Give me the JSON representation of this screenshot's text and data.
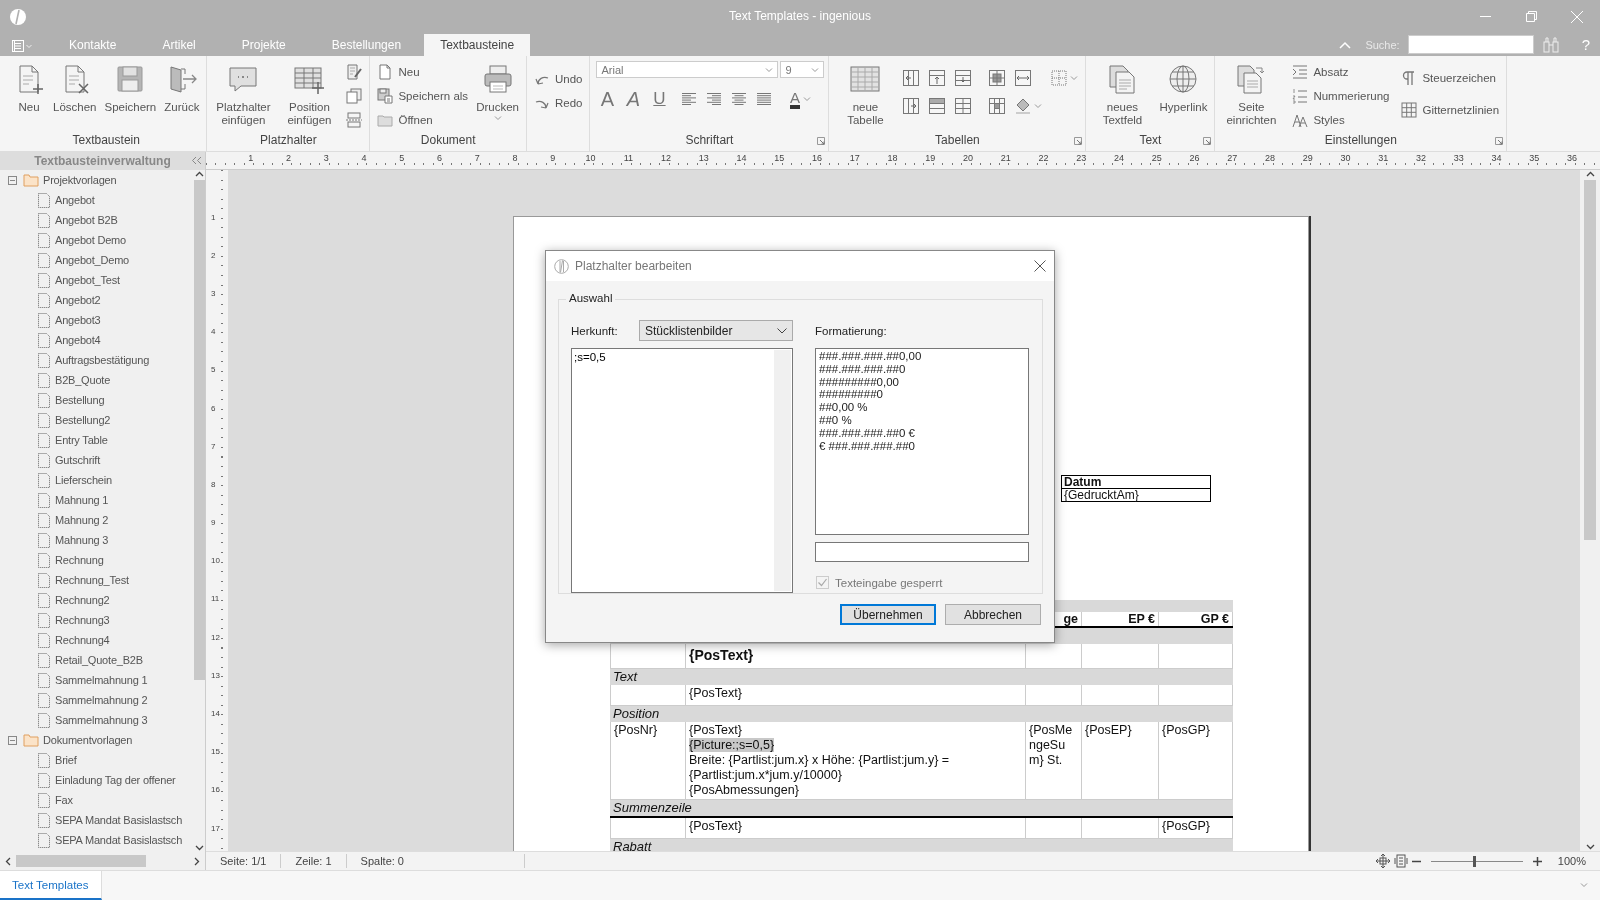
{
  "window": {
    "title": "Text Templates - ingenious"
  },
  "menu_tabs": [
    {
      "label": "Kontakte",
      "selected": false
    },
    {
      "label": "Artikel",
      "selected": false
    },
    {
      "label": "Projekte",
      "selected": false
    },
    {
      "label": "Bestellungen",
      "selected": false
    },
    {
      "label": "Textbausteine",
      "selected": true
    }
  ],
  "search": {
    "label": "Suche:"
  },
  "help": {
    "label": "?"
  },
  "ribbon": [
    {
      "title": "Textbaustein",
      "buttons": [
        {
          "kind": "large",
          "label": "Neu"
        },
        {
          "kind": "large",
          "label": "Löschen"
        },
        {
          "kind": "large",
          "label": "Speichern"
        },
        {
          "kind": "large",
          "label": "Zurück"
        }
      ]
    },
    {
      "title": "Platzhalter",
      "buttons": [
        {
          "kind": "large",
          "label": "Platzhalter einfügen"
        },
        {
          "kind": "large",
          "label": "Position einfügen"
        },
        {
          "kind": "icon"
        },
        {
          "kind": "icon"
        },
        {
          "kind": "icon"
        }
      ]
    },
    {
      "title": "Dokument",
      "buttons": [
        {
          "kind": "small",
          "label": "Neu"
        },
        {
          "kind": "small",
          "label": "Speichern als"
        },
        {
          "kind": "small",
          "label": "Öffnen"
        },
        {
          "kind": "large",
          "label": "Drucken"
        }
      ]
    },
    {
      "buttons": [
        {
          "kind": "small",
          "label": "Undo"
        },
        {
          "kind": "small",
          "label": "Redo"
        }
      ]
    },
    {
      "title": "Schriftart",
      "launcher": true,
      "font": {
        "family": "Arial",
        "size": "9"
      },
      "buttons": [
        {
          "kind": "glyph",
          "label": "A"
        },
        {
          "kind": "glyph",
          "label": "A"
        },
        {
          "kind": "glyph",
          "label": "U"
        },
        {
          "kind": "icon"
        },
        {
          "kind": "icon"
        },
        {
          "kind": "icon"
        },
        {
          "kind": "icon"
        },
        {
          "kind": "glyph",
          "label": "A"
        }
      ]
    },
    {
      "title": "Tabellen",
      "launcher": true,
      "buttons": [
        {
          "kind": "large",
          "label": "neue Tabelle"
        },
        {
          "kind": "icon"
        },
        {
          "kind": "icon"
        },
        {
          "kind": "icon"
        },
        {
          "kind": "icon"
        },
        {
          "kind": "icon"
        },
        {
          "kind": "icon"
        },
        {
          "kind": "icon"
        },
        {
          "kind": "icon"
        },
        {
          "kind": "icon"
        },
        {
          "kind": "icon"
        },
        {
          "kind": "icon"
        }
      ]
    },
    {
      "title": "Text",
      "launcher": true,
      "buttons": [
        {
          "kind": "large",
          "label": "neues Textfeld"
        },
        {
          "kind": "large",
          "label": "Hyperlink"
        }
      ]
    },
    {
      "title": "Einstellungen",
      "launcher": true,
      "buttons": [
        {
          "kind": "large",
          "label": "Seite einrichten"
        },
        {
          "kind": "small",
          "label": "Absatz"
        },
        {
          "kind": "small",
          "label": "Nummerierung"
        },
        {
          "kind": "small",
          "label": "Styles"
        },
        {
          "kind": "small",
          "label": "Steuerzeichen"
        },
        {
          "kind": "small",
          "label": "Gitternetzlinien"
        }
      ]
    }
  ],
  "sidebar": {
    "title": "Textbausteinverwaltung",
    "tree": [
      {
        "label": "Projektvorlagen",
        "expanded": true,
        "children": [
          {
            "label": "Angebot"
          },
          {
            "label": "Angebot B2B"
          },
          {
            "label": "Angebot Demo"
          },
          {
            "label": "Angebot_Demo"
          },
          {
            "label": "Angebot_Test"
          },
          {
            "label": "Angebot2"
          },
          {
            "label": "Angebot3"
          },
          {
            "label": "Angebot4"
          },
          {
            "label": "Auftragsbestätigung"
          },
          {
            "label": "B2B_Quote"
          },
          {
            "label": "Bestellung"
          },
          {
            "label": "Bestellung2"
          },
          {
            "label": "Entry Table"
          },
          {
            "label": "Gutschrift"
          },
          {
            "label": "Lieferschein"
          },
          {
            "label": "Mahnung 1"
          },
          {
            "label": "Mahnung 2"
          },
          {
            "label": "Mahnung 3"
          },
          {
            "label": "Rechnung"
          },
          {
            "label": "Rechnung_Test"
          },
          {
            "label": "Rechnung2"
          },
          {
            "label": "Rechnung3"
          },
          {
            "label": "Rechnung4"
          },
          {
            "label": "Retail_Quote_B2B"
          },
          {
            "label": "Sammelmahnung 1"
          },
          {
            "label": "Sammelmahnung 2"
          },
          {
            "label": "Sammelmahnung 3"
          }
        ]
      },
      {
        "label": "Dokumentvorlagen",
        "expanded": true,
        "children": [
          {
            "label": "Brief"
          },
          {
            "label": "Einladung Tag der offener"
          },
          {
            "label": "Fax"
          },
          {
            "label": "SEPA Mandat Basislastsch"
          },
          {
            "label": "SEPA Mandat Basislastsch"
          }
        ]
      }
    ]
  },
  "ruler": {
    "horizontal": [
      "1",
      "2",
      "3",
      "4",
      "5",
      "6",
      "7",
      "8",
      "9",
      "10",
      "11",
      "12",
      "13",
      "14",
      "15",
      "16",
      "17",
      "18",
      "19",
      "20",
      "21",
      "22",
      "23",
      "24",
      "25",
      "26",
      "27",
      "28",
      "29",
      "30",
      "31",
      "32",
      "33",
      "34",
      "35",
      "36"
    ],
    "vertical": [
      "1",
      "2",
      "3",
      "4",
      "5",
      "6",
      "7",
      "8",
      "9",
      "10",
      "11",
      "12",
      "13",
      "14",
      "15",
      "16",
      "17"
    ]
  },
  "document": {
    "date_box": {
      "header": "Datum",
      "value": "{GedrucktAm}"
    },
    "table": {
      "header": {
        "qty": "ge",
        "ep": "EP €",
        "gp": "GP €"
      },
      "blocks": [
        {
          "rows": [
            {
              "text_lines": [
                {
                  "text": "{PosText}",
                  "highlighted": false
                }
              ],
              "bold": true
            }
          ]
        },
        {
          "title": "Text",
          "rows": [
            {
              "text_lines": [
                {
                  "text": "{PosText}",
                  "highlighted": false
                }
              ],
              "bold": false
            }
          ]
        },
        {
          "title": "Position",
          "rows": [
            {
              "nr": "{PosNr}",
              "text_lines": [
                {
                  "text": "{PosText}",
                  "highlighted": false
                },
                {
                  "text": "{Picture:;s=0,5}",
                  "highlighted": true
                },
                {
                  "text": "Breite: {Partlist:jum.x} x Höhe: {Partlist:jum.y} =",
                  "highlighted": false
                },
                {
                  "text": "{Partlist:jum.x*jum.y/10000}",
                  "highlighted": false
                },
                {
                  "text": "{PosAbmessungen}",
                  "highlighted": false
                }
              ],
              "qty": "{PosMengeSum} St.",
              "ep": "{PosEP}",
              "gp": "{PosGP}",
              "bold": false
            }
          ]
        },
        {
          "title": "Summenzeile",
          "rows": [
            {
              "text_lines": [
                {
                  "text": "{PosText}",
                  "highlighted": false
                }
              ],
              "gp": "{PosGP}",
              "bold": false
            }
          ]
        },
        {
          "title": "Rabatt"
        }
      ]
    }
  },
  "dialog": {
    "title": "Platzhalter bearbeiten",
    "group": "Auswahl",
    "source_label": "Herkunft:",
    "source_value": "Stücklistenbilder",
    "expression": ";s=0,5",
    "format_label": "Formatierung:",
    "formats": [
      "###.###.###.##0,00",
      "###.###.###.##0",
      "#########0,00",
      "#########0",
      "##0,00 %",
      "##0 %",
      "###.###.###.##0 €",
      "€ ###.###.###.##0"
    ],
    "locked": {
      "label": "Texteingabe gesperrt",
      "checked": true,
      "disabled": true
    },
    "buttons": [
      {
        "label": "Übernehmen",
        "default": true
      },
      {
        "label": "Abbrechen",
        "default": false
      }
    ]
  },
  "status_bar": {
    "items": [
      "Seite: 1/1",
      "Zeile: 1",
      "Spalte: 0"
    ],
    "zoom": {
      "level": 0.47,
      "reading": "100%"
    }
  },
  "bottom_tabs": [
    {
      "label": "Text Templates",
      "selected": true
    }
  ]
}
